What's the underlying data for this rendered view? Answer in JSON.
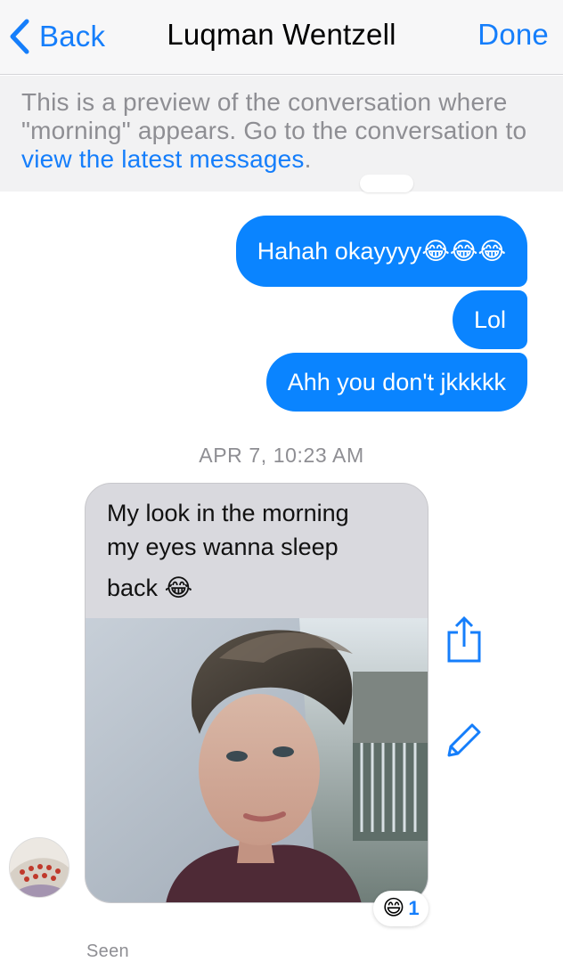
{
  "navbar": {
    "back_label": "Back",
    "title": "Luqman Wentzell",
    "done_label": "Done"
  },
  "preview": {
    "text": "This is a preview of the conversation where \"morning\" appears. Go to the conversation to",
    "link": "view the latest messages",
    "suffix": "."
  },
  "messages": {
    "out": [
      {
        "text": "Hahah okayyyy",
        "emoji": "😂😂😂"
      },
      {
        "text": "Lol"
      },
      {
        "text": "Ahh you don't jkkkkk"
      }
    ],
    "timestamp": "APR 7, 10:23 AM",
    "incoming": {
      "line1": "My look in the morning",
      "line2": "my eyes wanna sleep",
      "line3": "back",
      "emoji": "😂"
    },
    "reaction": {
      "emoji": "😄",
      "count": "1"
    },
    "status": "Seen"
  },
  "icons": {
    "back": "chevron-left-icon",
    "share": "share-icon",
    "edit": "pencil-icon"
  },
  "colors": {
    "accent": "#157efb",
    "outgoing_bubble": "#0a84ff",
    "incoming_bubble": "#d9d9de",
    "muted_text": "#8e8e93"
  }
}
